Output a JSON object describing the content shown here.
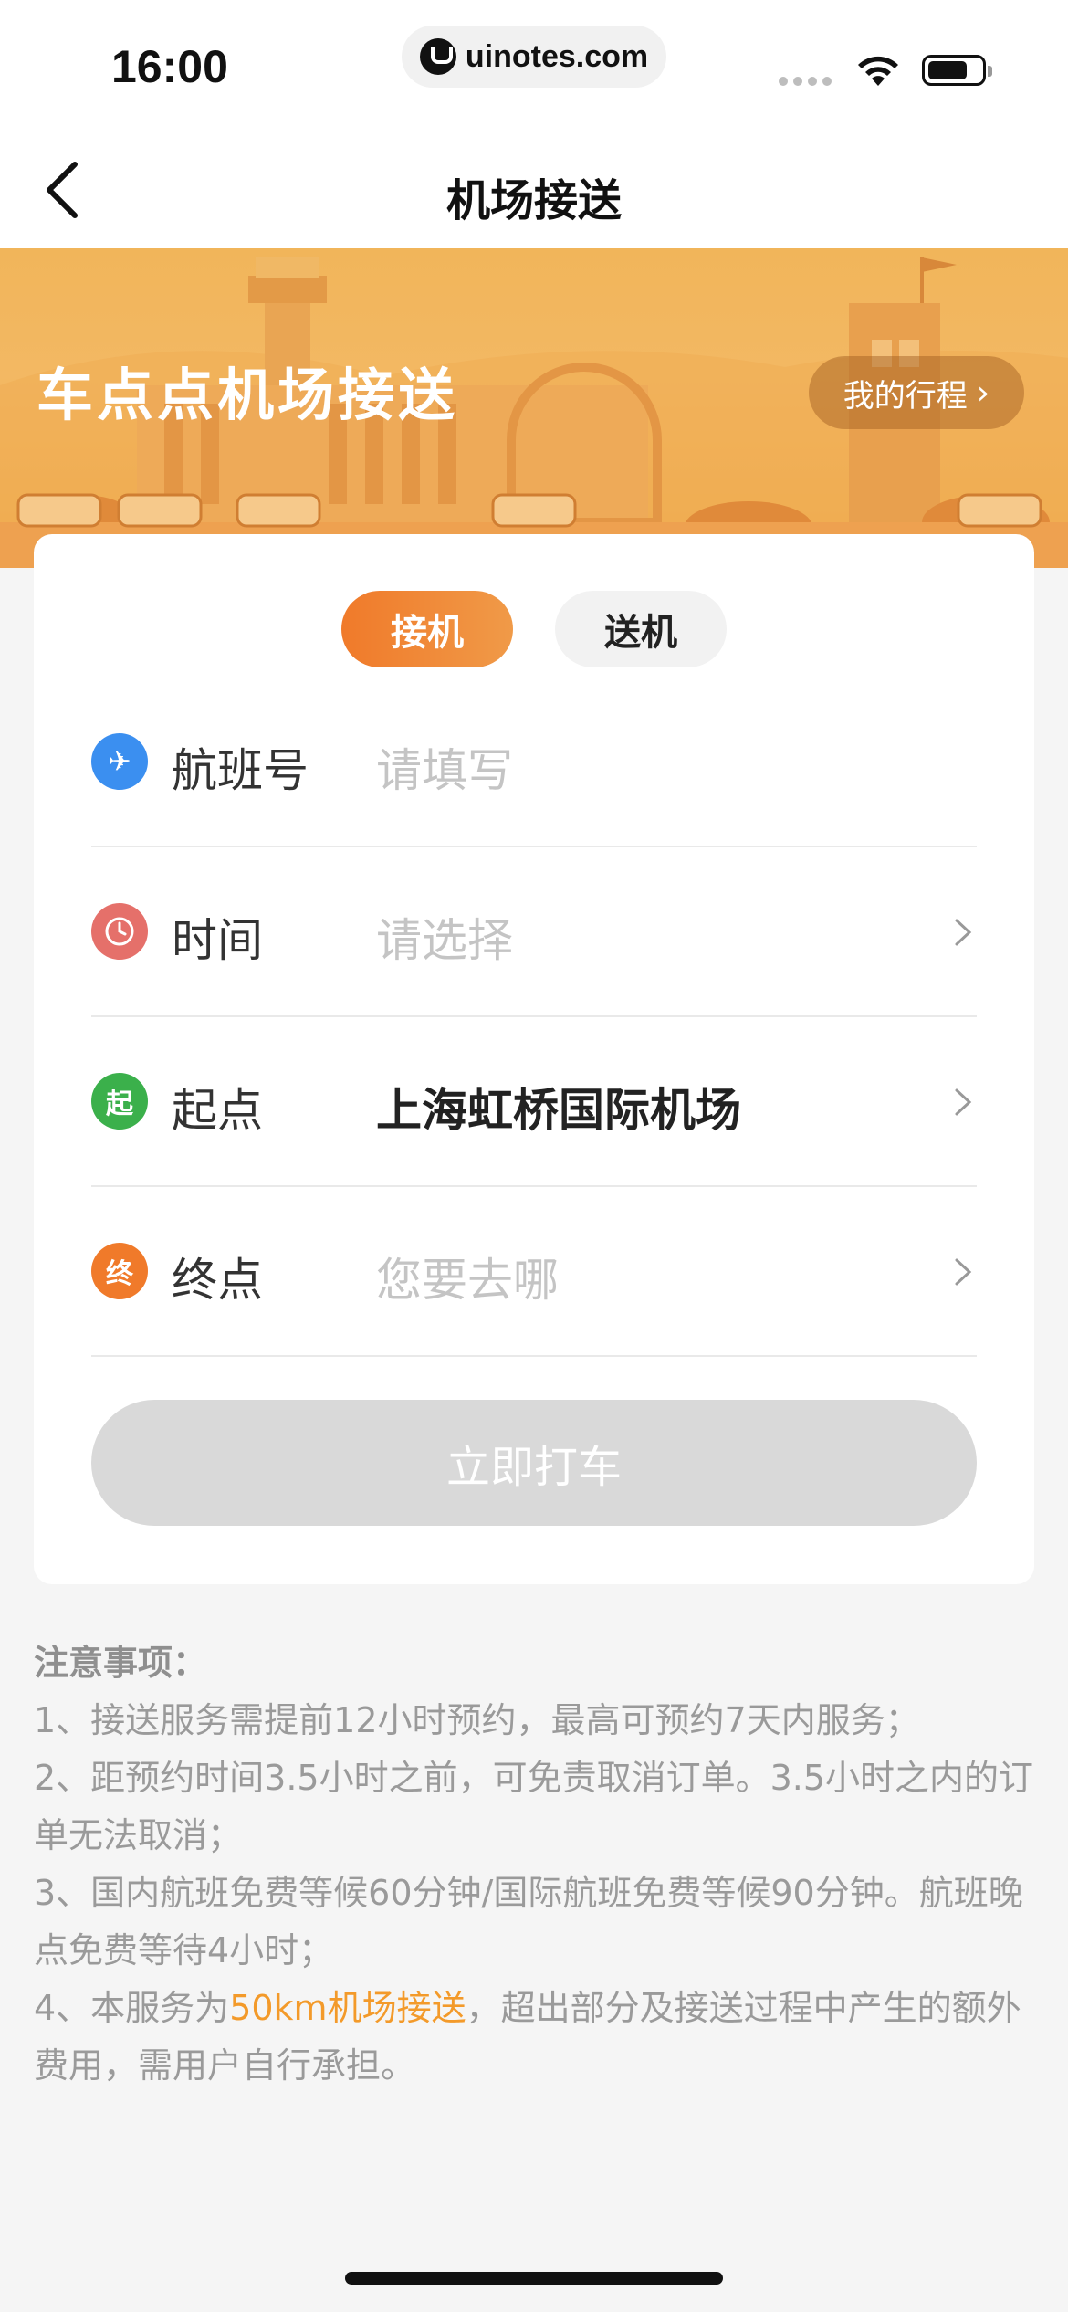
{
  "status": {
    "time": "16:00",
    "url": "uinotes.com"
  },
  "nav": {
    "title": "机场接送"
  },
  "banner": {
    "title": "车点点机场接送",
    "trip_label": "我的行程"
  },
  "tabs": [
    {
      "label": "接机",
      "active": true
    },
    {
      "label": "送机",
      "active": false
    }
  ],
  "form": {
    "flight": {
      "label": "航班号",
      "placeholder": "请填写"
    },
    "time": {
      "label": "时间",
      "placeholder": "请选择"
    },
    "start": {
      "label": "起点",
      "icon_text": "起",
      "value": "上海虹桥国际机场"
    },
    "end": {
      "label": "终点",
      "icon_text": "终",
      "placeholder": "您要去哪"
    },
    "submit_label": "立即打车"
  },
  "notes": {
    "title": "注意事项：",
    "item1": "1、接送服务需提前12小时预约，最高可预约7天内服务；",
    "item2": "2、距预约时间3.5小时之前，可免责取消订单。3.5小时之内的订单无法取消；",
    "item3": "3、国内航班免费等候60分钟/国际航班免费等候90分钟。航班晚点免费等待4小时；",
    "item4_prefix": "4、本服务为",
    "item4_highlight": "50km机场接送",
    "item4_suffix": "，超出部分及接送过程中产生的额外费用，需用户自行承担。"
  },
  "colors": {
    "accent": "#f07a2a",
    "highlight": "#f39a2a",
    "flight_icon": "#3b8ff0",
    "time_icon": "#e5706a",
    "start_icon": "#3bb04b",
    "end_icon": "#f07a2a"
  }
}
